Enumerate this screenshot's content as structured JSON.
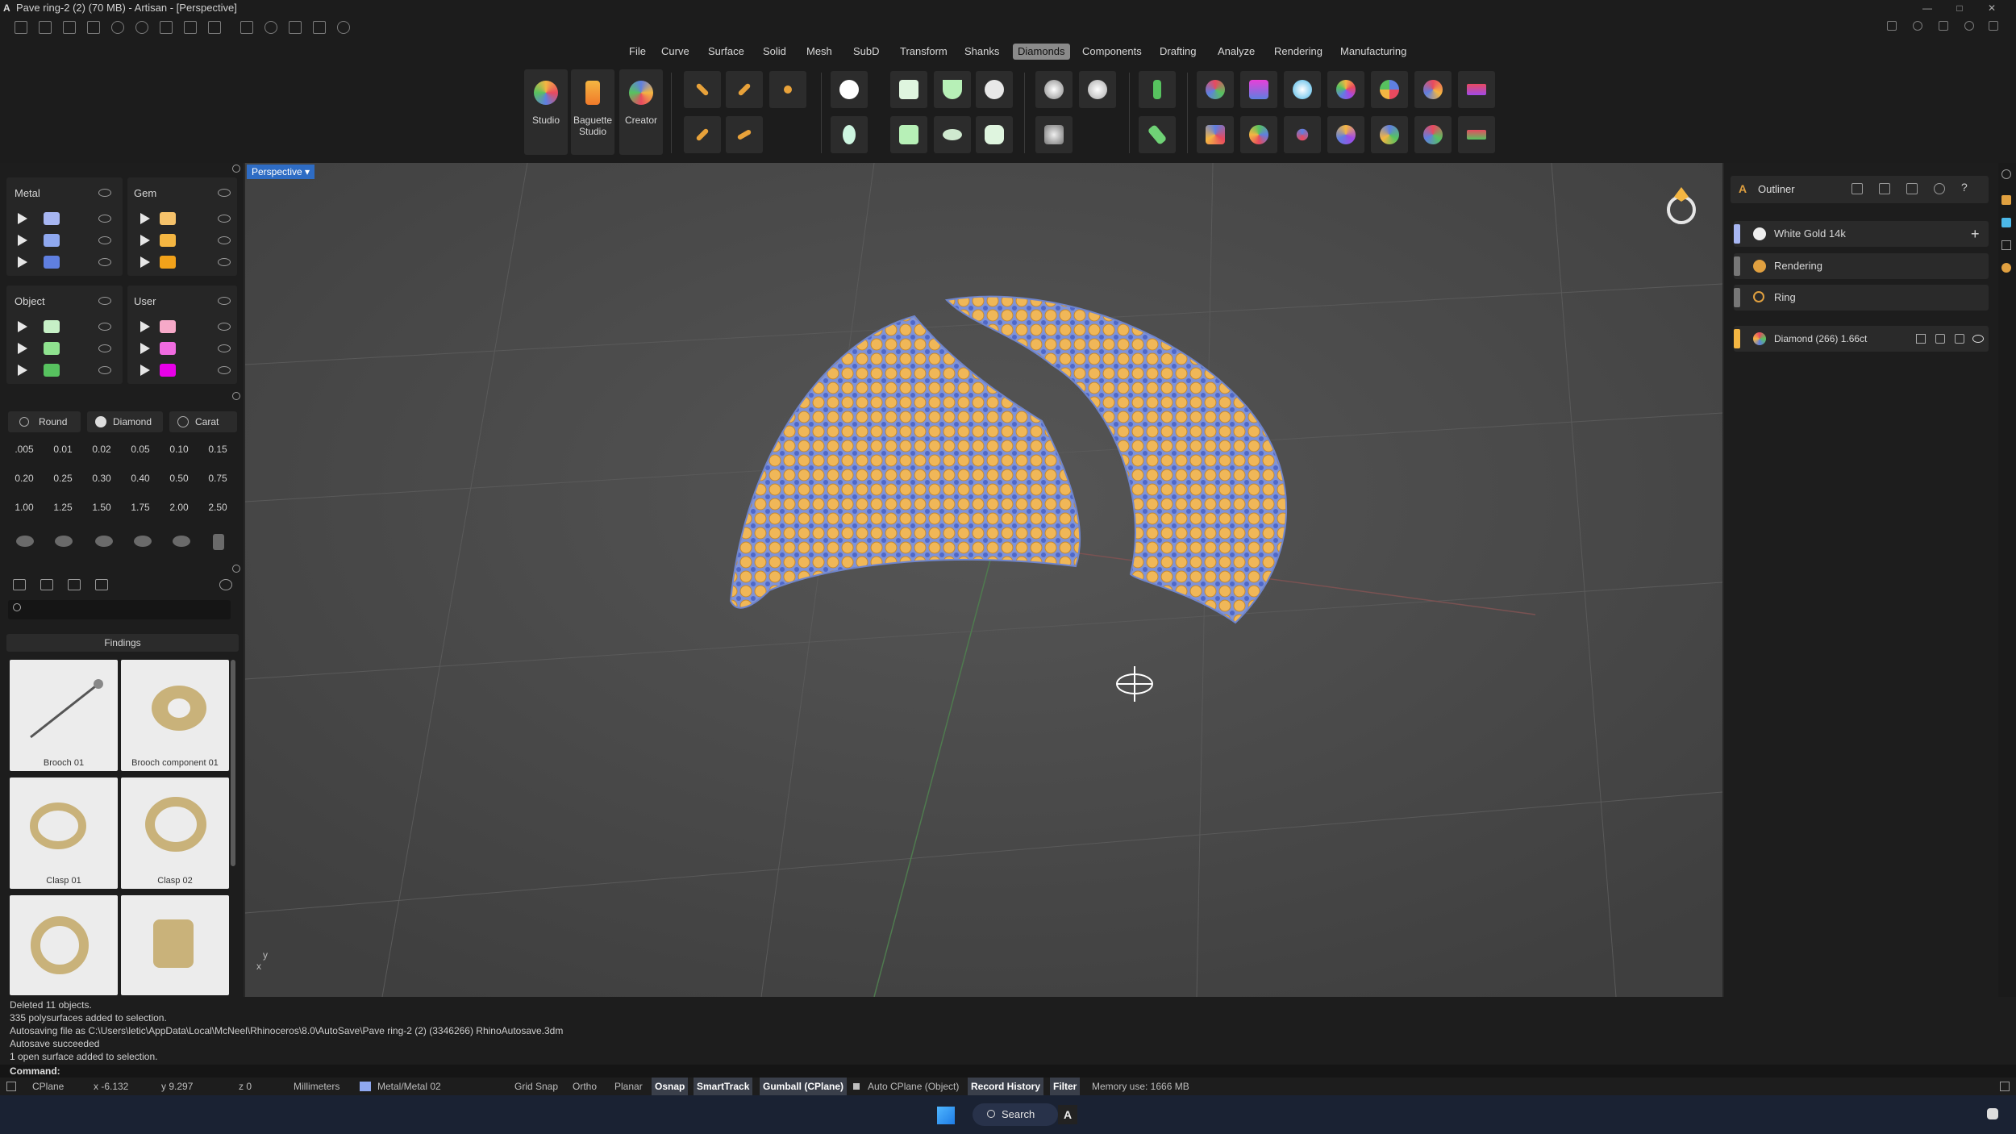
{
  "window": {
    "title": "Pave ring-2 (2) (70 MB) - Artisan - [Perspective]"
  },
  "menu": [
    "File",
    "Curve",
    "Surface",
    "Solid",
    "Mesh",
    "SubD",
    "Transform",
    "Shanks",
    "Diamonds",
    "Components",
    "Drafting",
    "Analyze",
    "Rendering",
    "Manufacturing"
  ],
  "menu_active": "Diamonds",
  "ribbon": {
    "studio": "Studio",
    "baguette": "Baguette Studio",
    "creator": "Creator"
  },
  "layers": {
    "metal": "Metal",
    "gem": "Gem",
    "object": "Object",
    "user": "User",
    "metal_colors": [
      "#a7b6f2",
      "#8fa8ef",
      "#5f7fe0"
    ],
    "gem_colors": [
      "#f5c26b",
      "#f4b642",
      "#f2a21a"
    ],
    "object_colors": [
      "#c6f0c6",
      "#8fe28f",
      "#57c25f"
    ],
    "user_colors": [
      "#f6a9c8",
      "#f06be0",
      "#e800e8"
    ]
  },
  "gems": {
    "cut": "Round",
    "type": "Diamond",
    "unit": "Carat",
    "sizes": [
      ".005",
      "0.01",
      "0.02",
      "0.05",
      "0.10",
      "0.15",
      "0.20",
      "0.25",
      "0.30",
      "0.40",
      "0.50",
      "0.75",
      "1.00",
      "1.25",
      "1.50",
      "1.75",
      "2.00",
      "2.50"
    ]
  },
  "library": {
    "category": "Findings",
    "items": [
      "Brooch 01",
      "Brooch component 01",
      "Clasp 01",
      "Clasp 02"
    ],
    "search_placeholder": ""
  },
  "viewport": {
    "label": "Perspective",
    "axis_x": "x",
    "axis_y": "y"
  },
  "outliner": {
    "title": "Outliner",
    "rows": [
      "White Gold 14k",
      "Rendering",
      "Ring",
      "Diamond (266) 1.66ct"
    ],
    "row_colors": [
      "#a7b6f2",
      "#777777",
      "#777777",
      "#f4b642"
    ]
  },
  "command_history": [
    "Deleted 11 objects.",
    "335 polysurfaces added to selection.",
    "Autosaving file as C:\\Users\\letic\\AppData\\Local\\McNeel\\Rhinoceros\\8.0\\AutoSave\\Pave ring-2 (2) (3346266) RhinoAutosave.3dm",
    "Autosave succeeded",
    "1 open surface added to selection."
  ],
  "command_prompt": "Command:",
  "status": {
    "cplane": "CPlane",
    "x": "x -6.132",
    "y": "y 9.297",
    "z": "z 0",
    "units": "Millimeters",
    "layer": "Metal/Metal 02",
    "toggles": [
      "Grid Snap",
      "Ortho",
      "Planar",
      "Osnap",
      "SmartTrack",
      "Gumball (CPlane)",
      "Auto CPlane (Object)",
      "Record History",
      "Filter"
    ],
    "toggles_on": [
      "Osnap",
      "SmartTrack",
      "Gumball (CPlane)",
      "Record History",
      "Filter"
    ],
    "memory": "Memory use: 1666 MB"
  },
  "taskbar": {
    "search": "Search"
  }
}
